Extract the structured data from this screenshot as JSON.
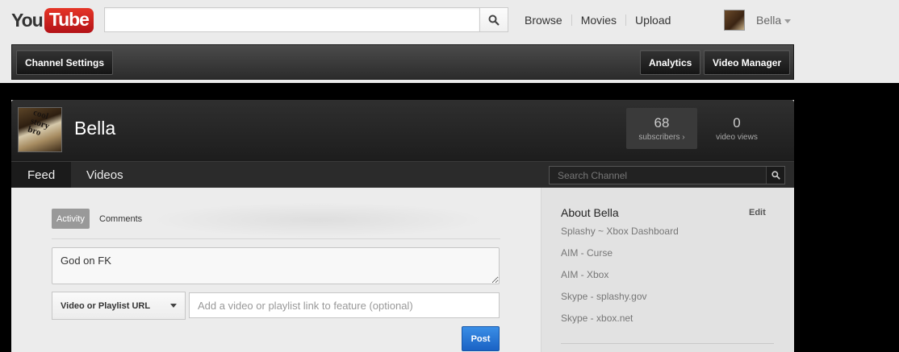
{
  "masthead": {
    "logo_you": "You",
    "logo_tube": "Tube",
    "search": {
      "placeholder": "",
      "value": ""
    },
    "nav": [
      "Browse",
      "Movies",
      "Upload"
    ],
    "user_name": "Bella"
  },
  "toolbar": {
    "channel_settings": "Channel Settings",
    "analytics": "Analytics",
    "video_manager": "Video Manager"
  },
  "channel": {
    "name": "Bella",
    "avatar_text": "cool story bro",
    "subscribers": {
      "count": "68",
      "label": "subscribers ›"
    },
    "video_views": {
      "count": "0",
      "label": "video views"
    },
    "tabs": [
      "Feed",
      "Videos"
    ],
    "search_placeholder": "Search Channel"
  },
  "feed": {
    "subtabs": [
      "Activity",
      "Comments"
    ],
    "post_text": "God on FK",
    "video_dropdown": "Video or Playlist URL",
    "video_url_placeholder": "Add a video or playlist link to feature (optional)",
    "post_button": "Post"
  },
  "about": {
    "title": "About Bella",
    "edit": "Edit",
    "links": [
      "Splashy ~ Xbox Dashboard",
      "AIM - Curse",
      "AIM - Xbox",
      "Skype - splashy.gov",
      "Skype - xbox.net"
    ]
  },
  "colors": {
    "brand_red": "#cc181e",
    "post_blue": "#1a62c4",
    "dark_bar": "#2b2b2b"
  }
}
